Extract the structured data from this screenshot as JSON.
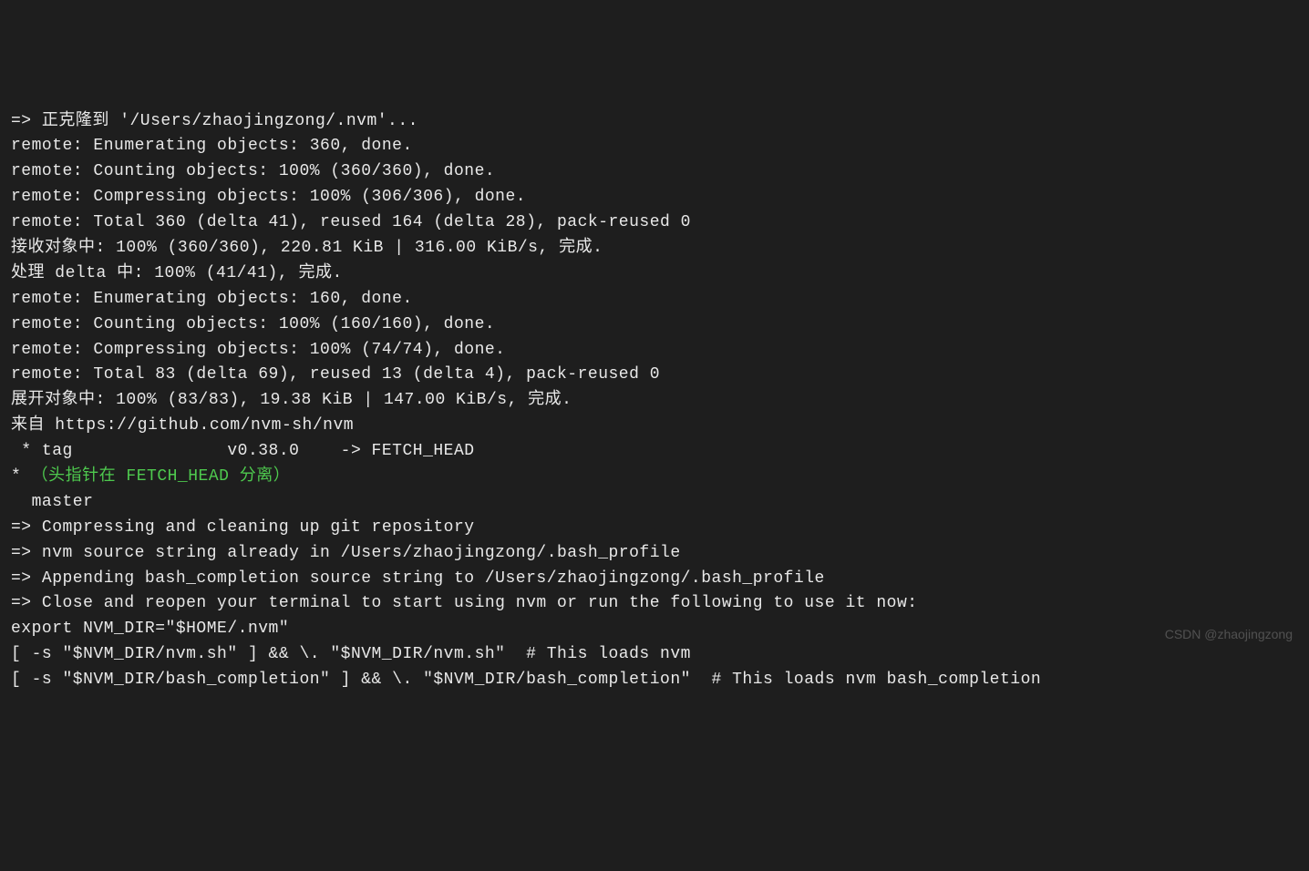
{
  "terminal": {
    "lines": [
      "=> 正克隆到 '/Users/zhaojingzong/.nvm'...",
      "remote: Enumerating objects: 360, done.",
      "remote: Counting objects: 100% (360/360), done.",
      "remote: Compressing objects: 100% (306/306), done.",
      "remote: Total 360 (delta 41), reused 164 (delta 28), pack-reused 0",
      "接收对象中: 100% (360/360), 220.81 KiB | 316.00 KiB/s, 完成.",
      "处理 delta 中: 100% (41/41), 完成.",
      "remote: Enumerating objects: 160, done.",
      "remote: Counting objects: 100% (160/160), done.",
      "remote: Compressing objects: 100% (74/74), done.",
      "remote: Total 83 (delta 69), reused 13 (delta 4), pack-reused 0",
      "展开对象中: 100% (83/83), 19.38 KiB | 147.00 KiB/s, 完成.",
      "来自 https://github.com/nvm-sh/nvm",
      " * tag               v0.38.0    -> FETCH_HEAD"
    ],
    "detached_prefix": "* ",
    "detached_head": "（头指针在 FETCH_HEAD 分离）",
    "lines_after": [
      "  master",
      "=> Compressing and cleaning up git repository",
      "",
      "=> nvm source string already in /Users/zhaojingzong/.bash_profile",
      "=> Appending bash_completion source string to /Users/zhaojingzong/.bash_profile",
      "=> Close and reopen your terminal to start using nvm or run the following to use it now:",
      "",
      "export NVM_DIR=\"$HOME/.nvm\"",
      "[ -s \"$NVM_DIR/nvm.sh\" ] && \\. \"$NVM_DIR/nvm.sh\"  # This loads nvm",
      "[ -s \"$NVM_DIR/bash_completion\" ] && \\. \"$NVM_DIR/bash_completion\"  # This loads nvm bash_completion"
    ]
  },
  "watermark": "CSDN @zhaojingzong"
}
